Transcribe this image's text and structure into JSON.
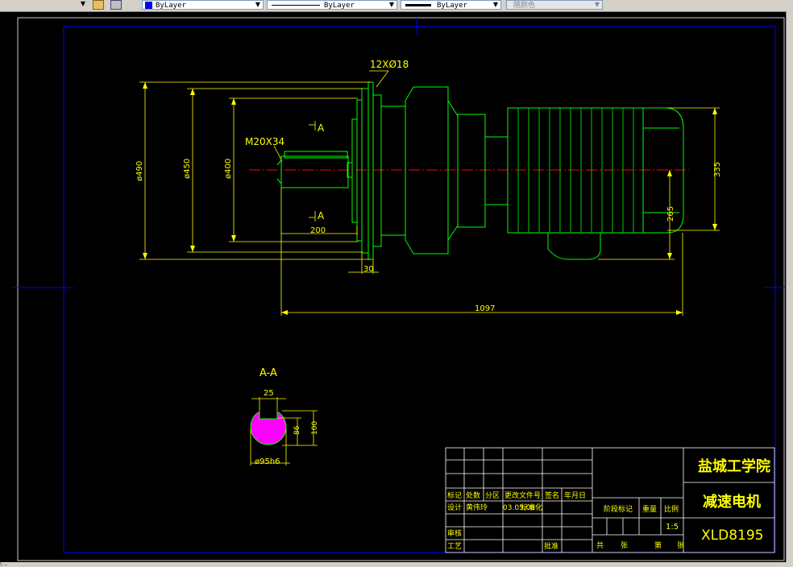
{
  "toolbar": {
    "color_value": "ByLayer",
    "linetype_value": "ByLayer",
    "lineweight_value": "ByLayer",
    "plotstyle_value": "随颜色"
  },
  "colors": {
    "background": "#000000",
    "border": "#0000ff",
    "geometry": "#00ff00",
    "dimension": "#ffff00",
    "centerline": "#ff0000",
    "title_text": "#ffff00",
    "section_fill": "#ff00ff"
  },
  "drawing": {
    "hole_label": "12XØ18",
    "thread_label": "M20X34",
    "section_mark_top": "A",
    "section_mark_bottom": "A",
    "dims": {
      "d490": "ø490",
      "d450": "ø450",
      "d400": "ø400",
      "len200": "200",
      "len30": "30",
      "len1097": "1097",
      "h335": "335",
      "h265": "265"
    },
    "section": {
      "title": "A-A",
      "width": "25",
      "h86": "86",
      "h100": "100",
      "dia": "ø95h6"
    }
  },
  "title_block": {
    "school": "盐城工学院",
    "part_name": "减速电机",
    "drawing_no": "XLD8195",
    "scale": "1:5",
    "date": "03.05.08",
    "hdr_mark": "标记",
    "hdr_count": "处数",
    "hdr_zone": "分区",
    "hdr_doc": "更改文件号",
    "hdr_sign": "签名",
    "hdr_date": "年月日",
    "row_design": "设计",
    "designer": "黄伟玲",
    "row_std": "标准化",
    "row_review": "审核",
    "row_process": "工艺",
    "row_approve": "批准",
    "stage": "阶段标记",
    "weight": "重量",
    "ratio": "比例",
    "total": "共",
    "sheet": "张",
    "page": "第",
    "page2": "张"
  },
  "status_text": "\\ ..."
}
